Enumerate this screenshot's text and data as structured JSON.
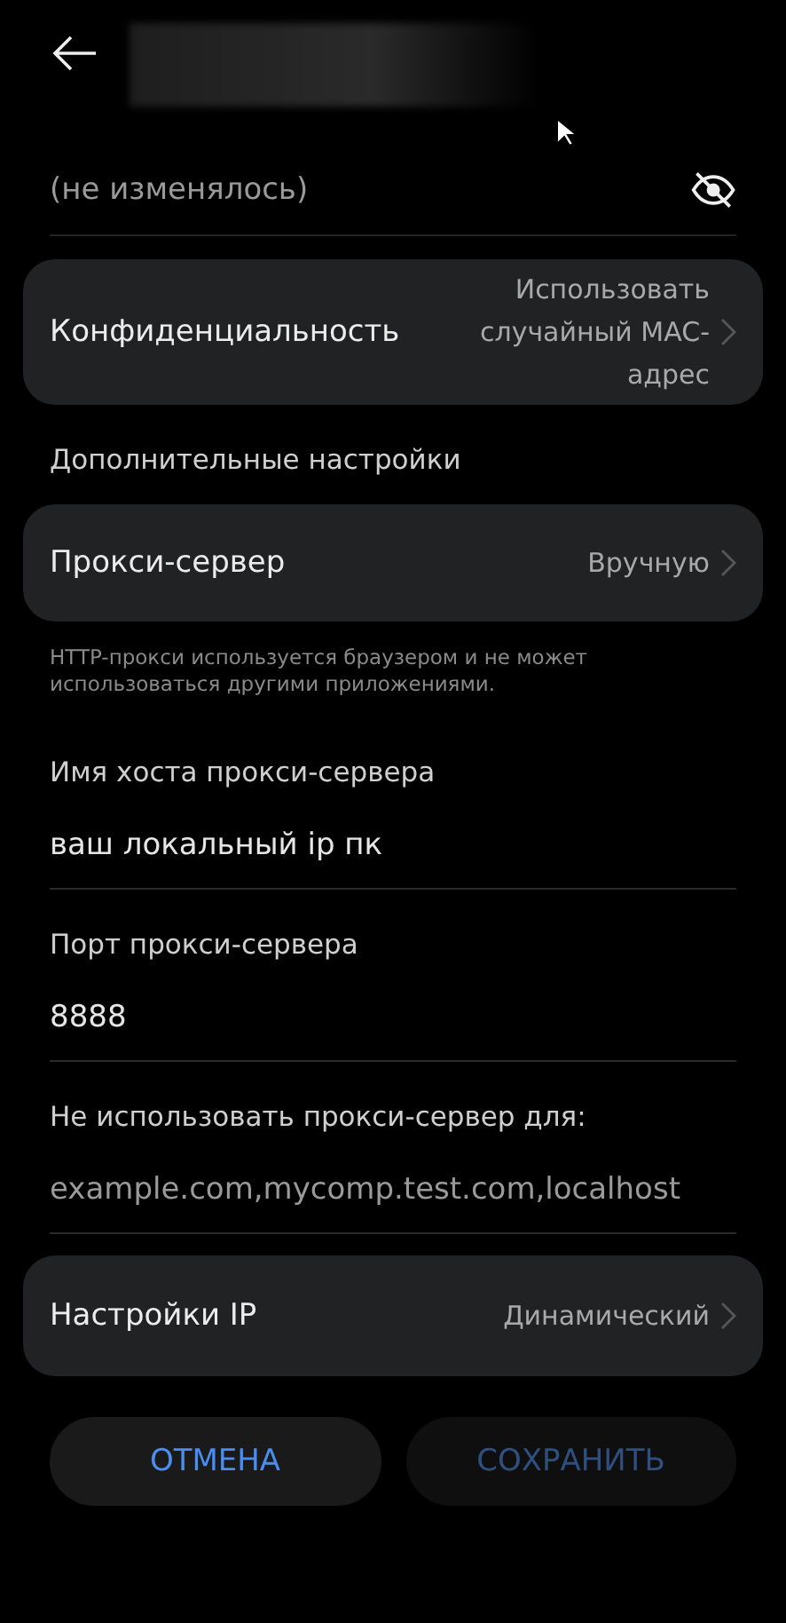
{
  "header": {
    "title_hidden": true
  },
  "password": {
    "placeholder": "(не изменялось)",
    "visible": false
  },
  "privacy": {
    "label": "Конфиденциальность",
    "value": "Использовать случайный MAC-адрес"
  },
  "section_title": "Дополнительные настройки",
  "proxy": {
    "label": "Прокси-сервер",
    "value": "Вручную"
  },
  "proxy_hint": "HTTP-прокси используется браузером и не может использоваться другими приложениями.",
  "fields": [
    {
      "label": "Имя хоста прокси-сервера",
      "value": "ваш локальный ip пк"
    },
    {
      "label": "Порт прокси-сервера",
      "value": "8888"
    },
    {
      "label": "Не использовать прокси-сервер для:",
      "placeholder": "example.com,mycomp.test.com,localhost"
    }
  ],
  "ip_settings": {
    "label": "Настройки IP",
    "value": "Динамический"
  },
  "buttons": [
    {
      "label": "ОТМЕНА",
      "disabled": false
    },
    {
      "label": "СОХРАНИТЬ",
      "disabled": true
    }
  ]
}
